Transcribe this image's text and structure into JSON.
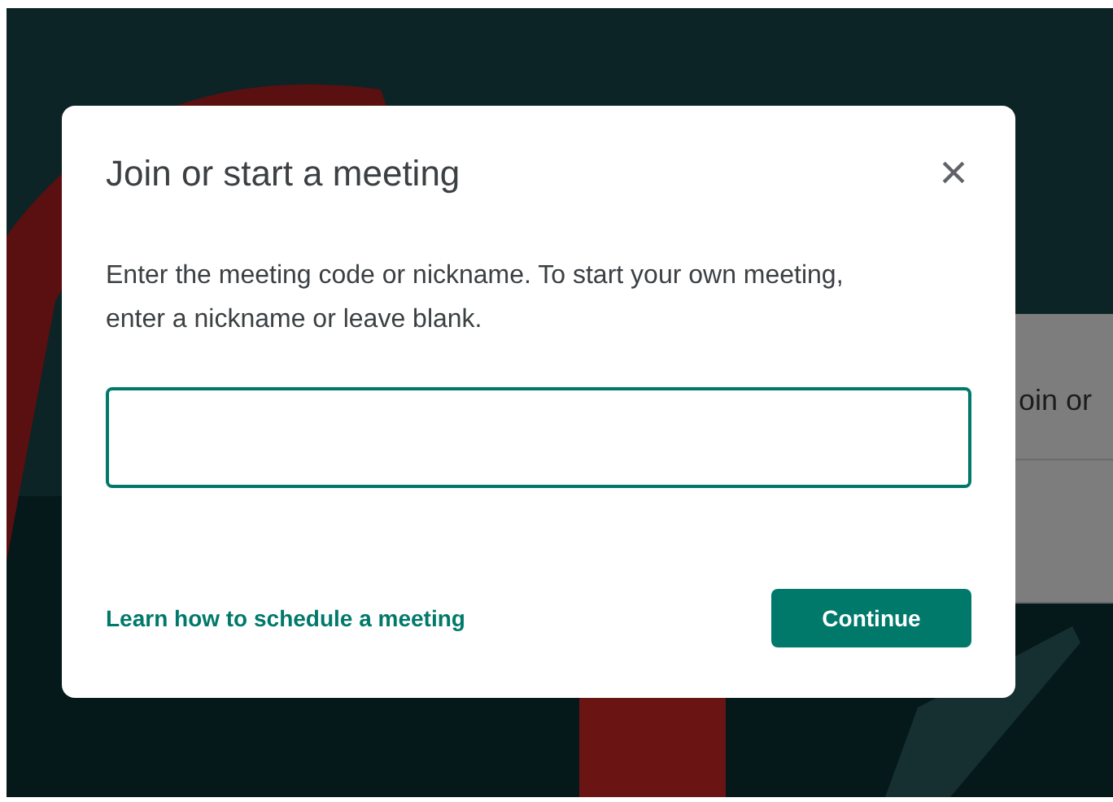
{
  "background": {
    "panel_text": "oin or"
  },
  "dialog": {
    "title": "Join or start a meeting",
    "close": "×",
    "description": "Enter the meeting code or nickname. To start your own meeting, enter a nickname or leave blank.",
    "input": {
      "focused": true
    },
    "link": "Learn how to schedule a meeting",
    "button": "Continue"
  }
}
